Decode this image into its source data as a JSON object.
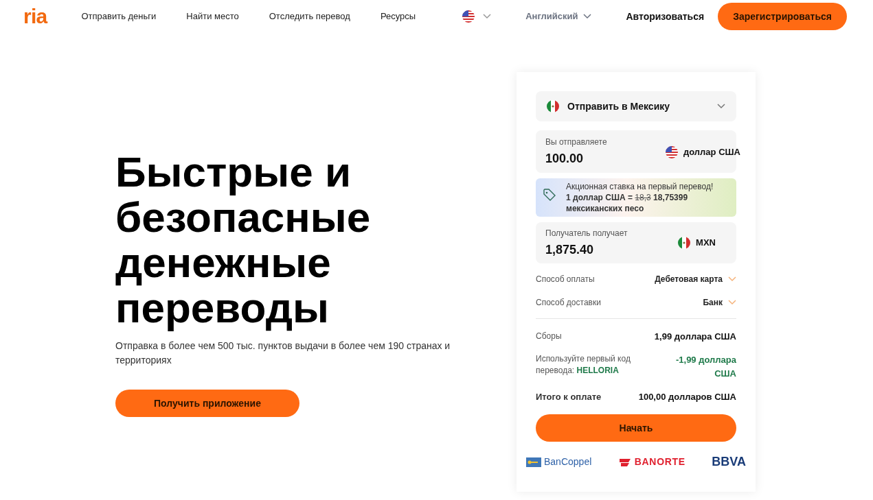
{
  "header": {
    "logo": "ria",
    "nav": [
      "Отправить деньги",
      "Найти место",
      "Отследить перевод",
      "Ресурсы"
    ],
    "language": "Английский",
    "login": "Авторизоваться",
    "signup": "Зарегистрироваться"
  },
  "hero": {
    "title": "Быстрые и безопасные денежные переводы",
    "subtitle": "Отправка в более чем 500 тыс. пунктов выдачи в более чем 190 странах и территориях",
    "app_button": "Получить приложение"
  },
  "calculator": {
    "destination": "Отправить в Мексику",
    "send": {
      "label": "Вы отправляете",
      "value": "100.00",
      "currency": "доллар США"
    },
    "promo": {
      "title": "Акционная ставка на первый перевод!",
      "rate_prefix": "1 доллар США =",
      "old_rate": "18,3",
      "new_rate": "18,75399",
      "rate_suffix": "мексиканских песо"
    },
    "receive": {
      "label": "Получатель получает",
      "value": "1,875.40",
      "currency": "MXN"
    },
    "options": [
      {
        "label": "Способ оплаты",
        "value": "Дебетовая карта"
      },
      {
        "label": "Способ доставки",
        "value": "Банк"
      }
    ],
    "fees": {
      "label": "Сборы",
      "value": "1,99 доллара США"
    },
    "discount": {
      "label": "Используйте первый код перевода:",
      "code": "HELLORIA",
      "value": "-1,99 доллара США"
    },
    "total": {
      "label": "Итого к оплате",
      "value": "100,00 долларов США"
    },
    "start_button": "Начать",
    "partners": [
      "BanCoppel",
      "BANORTE",
      "BBVA"
    ]
  }
}
